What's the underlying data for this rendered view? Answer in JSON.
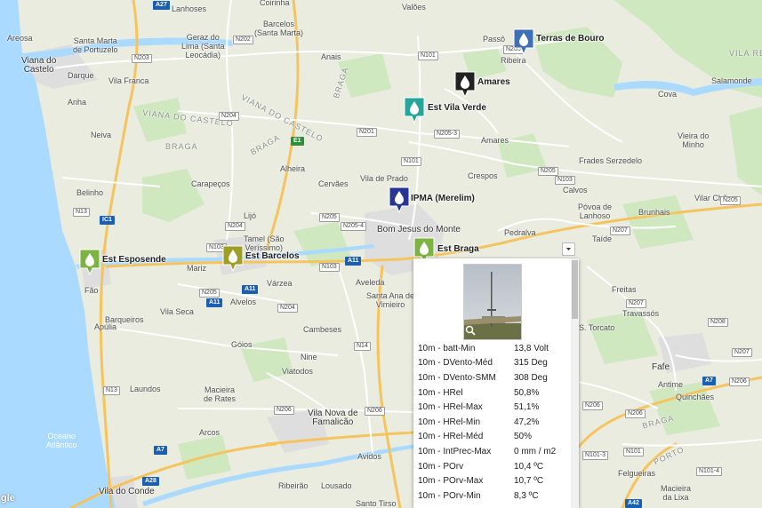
{
  "colors": {
    "water": "#aadaff",
    "land": "#e9ecdf",
    "park": "#cfe8c0",
    "urban": "#dcdcdc",
    "motorway": "#f5c45e",
    "road": "#ffffff",
    "marker_green": "#7cb342",
    "marker_teal": "#26a69a",
    "marker_navy": "#283593",
    "marker_blue": "#3f6fb5",
    "marker_black": "#222222",
    "marker_olive": "#9e9d24"
  },
  "places": [
    {
      "name": "Lanhoses"
    },
    {
      "name": "Coirinha"
    },
    {
      "name": "Valões"
    },
    {
      "name": "Areosa"
    },
    {
      "name": "Santa Marta\nde Portuzelo"
    },
    {
      "name": "Geraz do\nLima (Santa\nLeocádia)"
    },
    {
      "name": "Barcelos\n(Santa Marta)"
    },
    {
      "name": "Anais"
    },
    {
      "name": "Viana do\nCastelo"
    },
    {
      "name": "Darque"
    },
    {
      "name": "Vila Franca"
    },
    {
      "name": "Anha"
    },
    {
      "name": "Neiva"
    },
    {
      "name": "Belinho"
    },
    {
      "name": "Carapeços"
    },
    {
      "name": "Lijó"
    },
    {
      "name": "Alheira"
    },
    {
      "name": "Cervães"
    },
    {
      "name": "Vila de Prado"
    },
    {
      "name": "Passô"
    },
    {
      "name": "Ribeira"
    },
    {
      "name": "Cova"
    },
    {
      "name": "Salamonde"
    },
    {
      "name": "Vieira do\nMinho"
    },
    {
      "name": "Amares"
    },
    {
      "name": "Crespos"
    },
    {
      "name": "Frades Serzedelo"
    },
    {
      "name": "Calvos"
    },
    {
      "name": "Póvoa de\nLanhoso"
    },
    {
      "name": "Brunhais"
    },
    {
      "name": "Vilar Chão"
    },
    {
      "name": "Taíde"
    },
    {
      "name": "Pedralva"
    },
    {
      "name": "Bom Jesus do Monte"
    },
    {
      "name": "Tamel (São\nVeríssimo)"
    },
    {
      "name": "Mariz"
    },
    {
      "name": "Fão"
    },
    {
      "name": "Vila Seca"
    },
    {
      "name": "Alvelos"
    },
    {
      "name": "Várzea"
    },
    {
      "name": "Aveleda"
    },
    {
      "name": "Santa Ana de\nVimieiro"
    },
    {
      "name": "Barqueiros"
    },
    {
      "name": "Apúlia"
    },
    {
      "name": "Góios"
    },
    {
      "name": "Cambeses"
    },
    {
      "name": "Nine"
    },
    {
      "name": "Viatodos"
    },
    {
      "name": "Laundos"
    },
    {
      "name": "Macieira\nde Rates"
    },
    {
      "name": "Vila Nova de\nFamalicão"
    },
    {
      "name": "Arcos"
    },
    {
      "name": "Avidos"
    },
    {
      "name": "Ribeirão"
    },
    {
      "name": "Lousado"
    },
    {
      "name": "Vila do Conde"
    },
    {
      "name": "Santo Tirso"
    },
    {
      "name": "Freitas"
    },
    {
      "name": "Travassós"
    },
    {
      "name": "Fafe"
    },
    {
      "name": "Antime"
    },
    {
      "name": "Quinchães"
    },
    {
      "name": "Felgueiras"
    },
    {
      "name": "Macieira\nda Lixa"
    },
    {
      "name": "S. Torcato"
    }
  ],
  "regions": [
    {
      "name": "VIANA DO CASTELO"
    },
    {
      "name": "VIANA DO CASTELO"
    },
    {
      "name": "BRAGA"
    },
    {
      "name": "BRAGA"
    },
    {
      "name": "BRAGA"
    },
    {
      "name": "BRAGA"
    },
    {
      "name": "PORTO"
    },
    {
      "name": "VILA REAL"
    }
  ],
  "sea_label": "Oceano\nAtlântico",
  "roads": [
    {
      "label": "A27",
      "type": "blue"
    },
    {
      "label": "N203",
      "type": "white"
    },
    {
      "label": "N202",
      "type": "white"
    },
    {
      "label": "N204",
      "type": "white"
    },
    {
      "label": "N101",
      "type": "white"
    },
    {
      "label": "N201",
      "type": "white"
    },
    {
      "label": "N205-3",
      "type": "white"
    },
    {
      "label": "N101",
      "type": "white"
    },
    {
      "label": "N205",
      "type": "white"
    },
    {
      "label": "N103",
      "type": "white"
    },
    {
      "label": "N205",
      "type": "white"
    },
    {
      "label": "E1",
      "type": "green"
    },
    {
      "label": "N13",
      "type": "white"
    },
    {
      "label": "IC1",
      "type": "blue"
    },
    {
      "label": "N204",
      "type": "white"
    },
    {
      "label": "N205",
      "type": "white"
    },
    {
      "label": "N205-4",
      "type": "white"
    },
    {
      "label": "N103",
      "type": "white"
    },
    {
      "label": "A11",
      "type": "blue"
    },
    {
      "label": "A11",
      "type": "blue"
    },
    {
      "label": "N205",
      "type": "white"
    },
    {
      "label": "A11",
      "type": "blue"
    },
    {
      "label": "N204",
      "type": "white"
    },
    {
      "label": "N14",
      "type": "white"
    },
    {
      "label": "N13",
      "type": "white"
    },
    {
      "label": "N206",
      "type": "white"
    },
    {
      "label": "N206",
      "type": "white"
    },
    {
      "label": "A7",
      "type": "blue"
    },
    {
      "label": "A28",
      "type": "blue"
    },
    {
      "label": "N207",
      "type": "white"
    },
    {
      "label": "N207",
      "type": "white"
    },
    {
      "label": "N206",
      "type": "white"
    },
    {
      "label": "N206",
      "type": "white"
    },
    {
      "label": "A7",
      "type": "blue"
    },
    {
      "label": "N206",
      "type": "white"
    },
    {
      "label": "N101-3",
      "type": "white"
    },
    {
      "label": "N101-4",
      "type": "white"
    },
    {
      "label": "N101",
      "type": "white"
    },
    {
      "label": "A42",
      "type": "blue"
    },
    {
      "label": "A7",
      "type": "blue"
    },
    {
      "label": "N205",
      "type": "white"
    },
    {
      "label": "N103",
      "type": "white"
    },
    {
      "label": "N208",
      "type": "white"
    },
    {
      "label": "N207",
      "type": "white"
    }
  ],
  "markers": [
    {
      "label": "Terras de Bouro",
      "color": "#3f6fb5"
    },
    {
      "label": "Amares",
      "color": "#222222"
    },
    {
      "label": "Est Vila Verde",
      "color": "#26a69a"
    },
    {
      "label": "IPMA (Merelim)",
      "color": "#283593"
    },
    {
      "label": "Est Braga",
      "color": "#7cb342"
    },
    {
      "label": "Est Barcelos",
      "color": "#9e9d24"
    },
    {
      "label": "Est Esposende",
      "color": "#7cb342"
    }
  ],
  "popup": {
    "rows": [
      {
        "key": "10m - batt-Min",
        "value": "13,8 Volt"
      },
      {
        "key": "10m - DVento-Méd",
        "value": "315 Deg"
      },
      {
        "key": "10m - DVento-SMM",
        "value": "308 Deg"
      },
      {
        "key": "10m - HRel",
        "value": "50,8%"
      },
      {
        "key": "10m - HRel-Max",
        "value": "51,1%"
      },
      {
        "key": "10m - HRel-Min",
        "value": "47,2%"
      },
      {
        "key": "10m - HRel-Méd",
        "value": "50%"
      },
      {
        "key": "10m - IntPrec-Max",
        "value": "0 mm / m2"
      },
      {
        "key": "10m - POrv",
        "value": "10,4 ºC"
      },
      {
        "key": "10m - POrv-Max",
        "value": "10,7 ºC"
      },
      {
        "key": "10m - POrv-Min",
        "value": "8,3 ºC"
      }
    ]
  },
  "attribution": "gle"
}
